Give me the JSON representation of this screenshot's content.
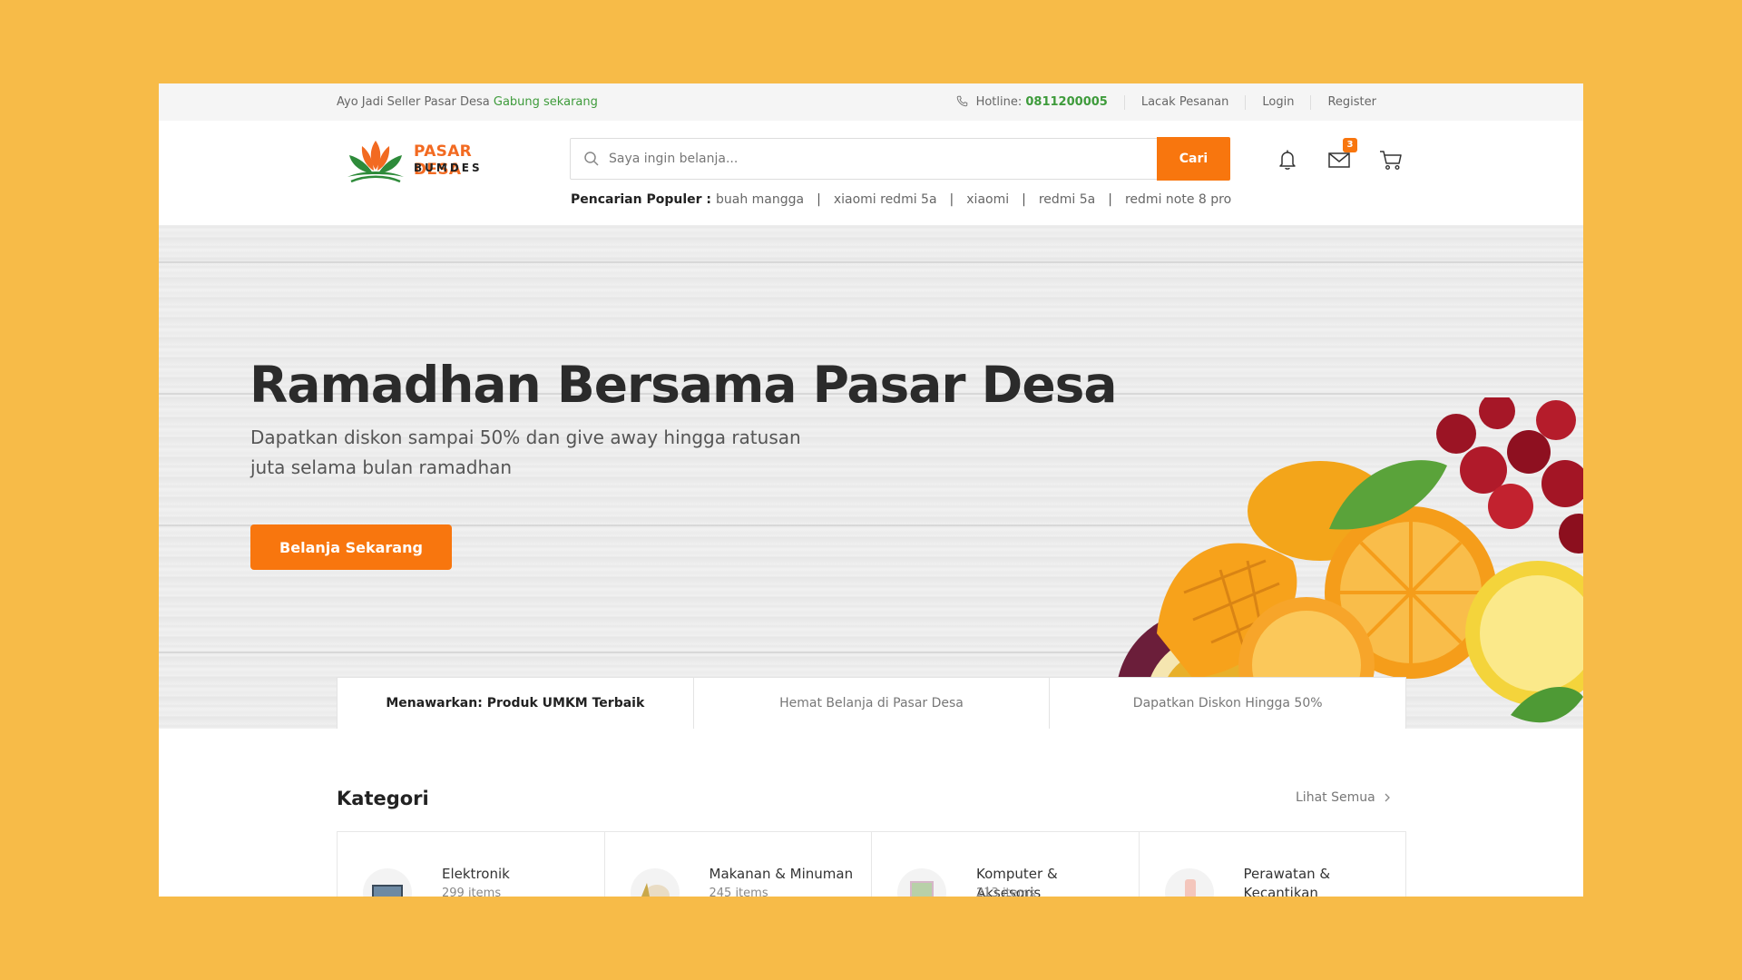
{
  "topbar": {
    "seller_text": "Ayo Jadi Seller Pasar Desa",
    "join_link": "Gabung sekarang",
    "hotline_label": "Hotline:",
    "hotline_number": "0811200005",
    "track_order": "Lacak Pesanan",
    "login": "Login",
    "register": "Register"
  },
  "logo": {
    "line1": "PASAR DESA",
    "line2": "BUMDES"
  },
  "search": {
    "placeholder": "Saya ingin belanja...",
    "button": "Cari"
  },
  "popular": {
    "label": "Pencarian Populer :",
    "items": [
      "buah mangga",
      "xiaomi redmi 5a",
      "xiaomi",
      "redmi 5a",
      "redmi note 8 pro"
    ]
  },
  "header_icons": {
    "mail_badge": "3"
  },
  "hero": {
    "title": "Ramadhan Bersama Pasar Desa",
    "subtitle": "Dapatkan diskon sampai 50% dan give away hingga ratusan juta selama bulan ramadhan",
    "cta": "Belanja Sekarang"
  },
  "features": [
    "Menawarkan: Produk UMKM Terbaik",
    "Hemat Belanja di Pasar Desa",
    "Dapatkan Diskon Hingga 50%"
  ],
  "categories": {
    "title": "Kategori",
    "see_all": "Lihat Semua",
    "items": [
      {
        "name": "Elektronik",
        "count": "299 items"
      },
      {
        "name": "Makanan & Minuman",
        "count": "245 items"
      },
      {
        "name": "Komputer & Aksesoris",
        "count": "213 items"
      },
      {
        "name": "Perawatan & Kecantikan",
        "count": ""
      }
    ]
  },
  "colors": {
    "background": "#f7bb48",
    "accent": "#f8760e",
    "green": "#3e9b3b"
  }
}
